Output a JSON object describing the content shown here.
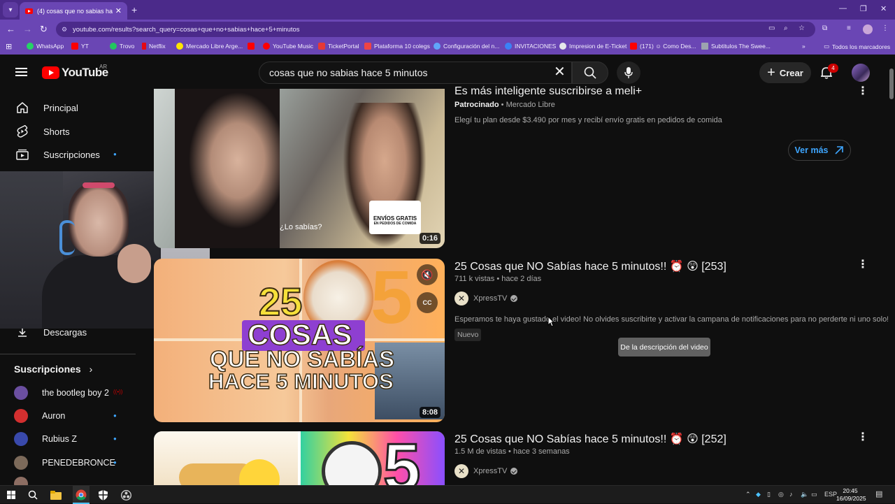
{
  "browser": {
    "tab_title": "(4) cosas que no sabias hace 5",
    "url": "youtube.com/results?search_query=cosas+que+no+sabias+hace+5+minutos",
    "bookmarks": [
      {
        "label": "WhatsApp",
        "color": "#25d366"
      },
      {
        "label": "YT",
        "color": "#ff0000"
      },
      {
        "label": "Trovo",
        "color": "#22c55e"
      },
      {
        "label": "Netflix",
        "color": "#e50914"
      },
      {
        "label": "Mercado Libre Arge...",
        "color": "#ffe600"
      },
      {
        "label": "",
        "color": "#ff0000"
      },
      {
        "label": "YouTube Music",
        "color": "#ff0000"
      },
      {
        "label": "TicketPortal",
        "color": "#e53935"
      },
      {
        "label": "Plataforma 10 colegs",
        "color": "#ef4444"
      },
      {
        "label": "Configuración del n...",
        "color": "#60a5fa"
      },
      {
        "label": "INVITACIONES",
        "color": "#3b82f6"
      },
      {
        "label": "Impresion de E-Ticket",
        "color": "#e5e7eb"
      },
      {
        "label": "(171) ☺ Como Des...",
        "color": "#ff0000"
      },
      {
        "label": "Subtitulos The Swee...",
        "color": "#9ca3af"
      }
    ],
    "all_bookmarks": "Todos los marcadores"
  },
  "header": {
    "logo_text": "YouTube",
    "country_code": "AR",
    "search_value": "cosas que no sabias hace 5 minutos",
    "create_label": "Crear",
    "notification_count": "4"
  },
  "sidebar": {
    "items": [
      {
        "label": "Principal",
        "icon": "home-icon"
      },
      {
        "label": "Shorts",
        "icon": "shorts-icon"
      },
      {
        "label": "Suscripciones",
        "icon": "subscriptions-icon"
      }
    ],
    "downloads_label": "Descargas",
    "subscriptions_heading": "Suscripciones",
    "subscriptions": [
      {
        "name": "the bootleg boy 2",
        "live": true,
        "color": "#6b4fa0"
      },
      {
        "name": "Auron",
        "live": false,
        "color": "#d32f2f"
      },
      {
        "name": "Rubius Z",
        "live": false,
        "color": "#3949ab"
      },
      {
        "name": "PENEDEBRONCE",
        "live": false,
        "color": "#7c6a5a"
      }
    ]
  },
  "results": [
    {
      "title": "Es más inteligente suscribirse a meli+",
      "sponsored_label": "Patrocinado",
      "advertiser": "Mercado Libre",
      "description": "Elegí tu plan desde $3.490 por mes y recibí envío gratis en pedidos de comida",
      "duration": "0:16",
      "thumb_caption": "¿Lo sabías?",
      "thumb_badge_line1": "ENVÍOS GRATIS",
      "thumb_badge_line2": "EN PEDIDOS DE COMIDA",
      "cta_label": "Ver más"
    },
    {
      "title": "25 Cosas que NO Sabías hace 5 minutos!! ⏰ 😲 [253]",
      "views": "711 k vistas",
      "age": "hace 2 días",
      "channel": "XpressTV",
      "description": "Esperamos te haya gustado el video! No olvides suscribirte y activar la campana de notificaciones para no perderte ni uno solo!",
      "badge": "Nuevo",
      "duration": "8:08",
      "thumb_line1": "25",
      "thumb_line2": "COSAS",
      "thumb_line3": "QUE NO SABÍAS",
      "thumb_line4": "HACE 5 MINUTOS",
      "thumb_big_number": "5",
      "tooltip": "De la descripción del video"
    },
    {
      "title": "25 Cosas que NO Sabías hace 5 minutos!! ⏰ 😲 [252]",
      "views": "1.5 M de vistas",
      "age": "hace 3 semanas",
      "channel": "XpressTV",
      "thumb_big_number": "5"
    }
  ],
  "taskbar": {
    "language": "ESP",
    "time": "20:45",
    "date": "16/09/2025"
  }
}
